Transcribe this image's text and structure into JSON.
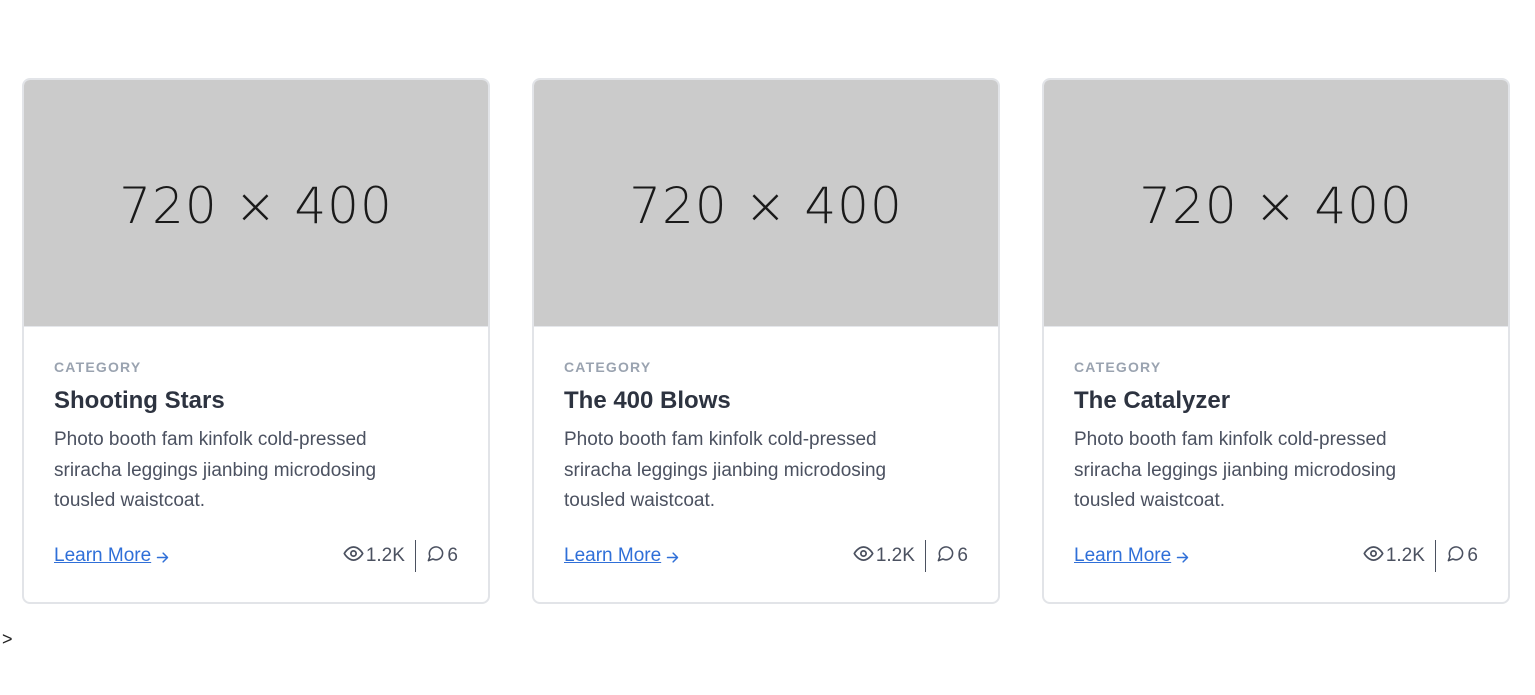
{
  "cards": [
    {
      "image_text": "720 × 400",
      "category": "CATEGORY",
      "title": "Shooting Stars",
      "description": "Photo booth fam kinfolk cold-pressed sriracha leggings jianbing microdosing tousled waistcoat.",
      "link_label": "Learn More",
      "views": "1.2K",
      "comments": "6"
    },
    {
      "image_text": "720 × 400",
      "category": "CATEGORY",
      "title": "The 400 Blows",
      "description": "Photo booth fam kinfolk cold-pressed sriracha leggings jianbing microdosing tousled waistcoat.",
      "link_label": "Learn More",
      "views": "1.2K",
      "comments": "6"
    },
    {
      "image_text": "720 × 400",
      "category": "CATEGORY",
      "title": "The Catalyzer",
      "description": "Photo booth fam kinfolk cold-pressed sriracha leggings jianbing microdosing tousled waistcoat.",
      "link_label": "Learn More",
      "views": "1.2K",
      "comments": "6"
    }
  ],
  "stray_text": ">",
  "icons": {
    "link_arrow": "arrow-right-icon",
    "views": "eye-icon",
    "comments": "chat-bubble-icon"
  },
  "colors": {
    "link": "#2f6fd8",
    "placeholder_bg": "#cbcbcb",
    "category": "#9aa3b0",
    "border": "#e2e4e8"
  }
}
